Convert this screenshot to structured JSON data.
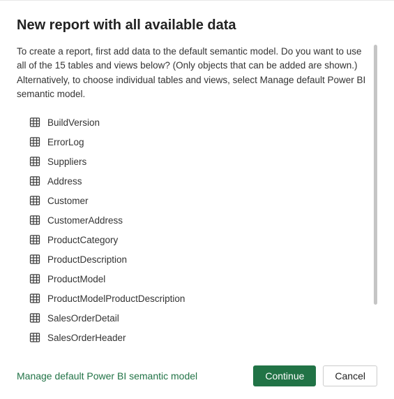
{
  "dialog": {
    "title": "New report with all available data",
    "description": "To create a report, first add data to the default semantic model. Do you want to use all of the 15 tables and views below? (Only objects that can be added are shown.) Alternatively, to choose individual tables and views, select Manage default Power BI semantic model."
  },
  "tables": [
    "BuildVersion",
    "ErrorLog",
    "Suppliers",
    "Address",
    "Customer",
    "CustomerAddress",
    "ProductCategory",
    "ProductDescription",
    "ProductModel",
    "ProductModelProductDescription",
    "SalesOrderDetail",
    "SalesOrderHeader"
  ],
  "footer": {
    "manage_link": "Manage default Power BI semantic model",
    "continue_label": "Continue",
    "cancel_label": "Cancel"
  },
  "colors": {
    "accent": "#217346"
  }
}
